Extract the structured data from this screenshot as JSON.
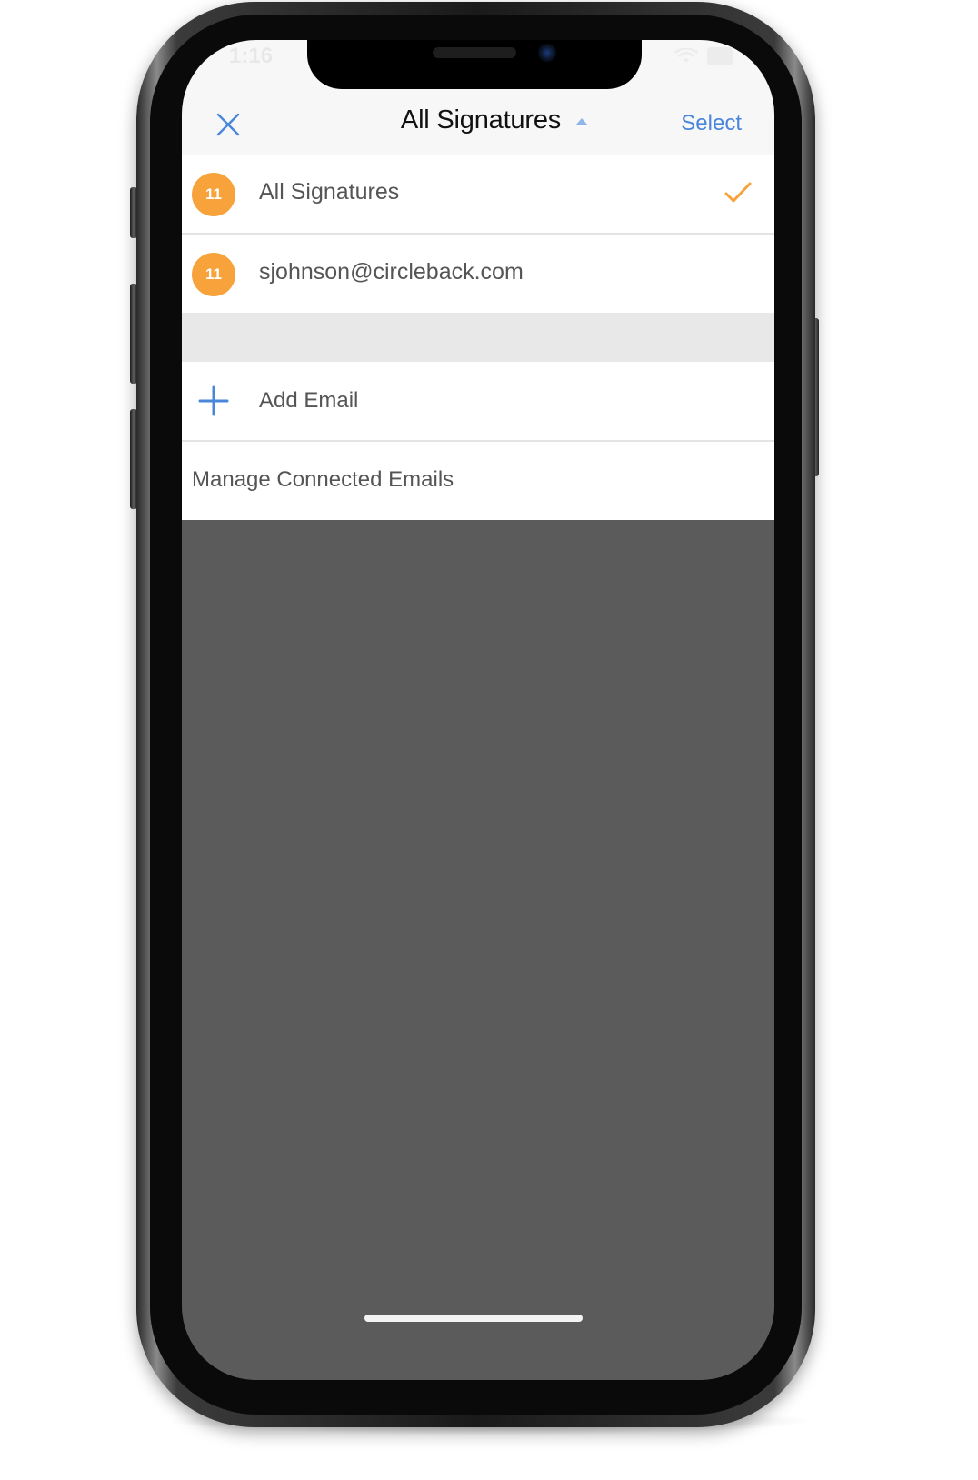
{
  "status_bar": {
    "time": "1:16"
  },
  "nav": {
    "title": "All Signatures",
    "select_label": "Select"
  },
  "signature_list": [
    {
      "count": "11",
      "label": "All Signatures",
      "selected": true
    },
    {
      "count": "11",
      "label": "sjohnson@circleback.com",
      "selected": false
    }
  ],
  "actions": {
    "add_email_label": "Add Email",
    "manage_label": "Manage Connected Emails"
  },
  "colors": {
    "accent_blue": "#4a86d9",
    "badge_orange": "#f7a23a",
    "check_orange": "#f7a23a",
    "overlay_gray": "#5b5b5b"
  },
  "icons": {
    "close": "close-icon",
    "caret": "caret-up-icon",
    "check": "checkmark-icon",
    "add": "plus-icon"
  }
}
